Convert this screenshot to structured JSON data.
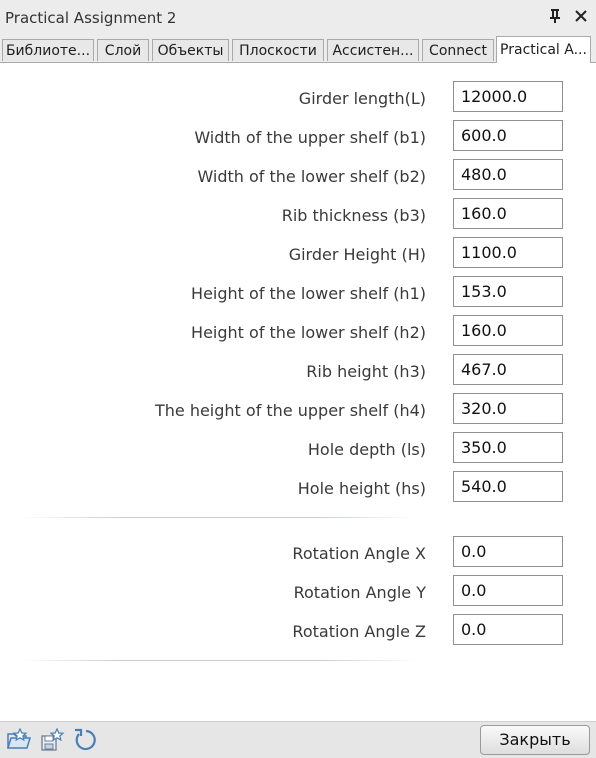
{
  "window": {
    "title": "Practical Assignment 2",
    "pin_icon": "pin-icon",
    "close_icon": "close-icon"
  },
  "tabs": [
    {
      "label": "Библиоте..."
    },
    {
      "label": "Слой"
    },
    {
      "label": "Объекты"
    },
    {
      "label": "Плоскости"
    },
    {
      "label": "Ассистен..."
    },
    {
      "label": "Connect"
    },
    {
      "label": "Practical A...",
      "active": true
    }
  ],
  "params": [
    {
      "label": "Girder length(L)",
      "value": "12000.0"
    },
    {
      "label": "Width of the upper shelf (b1)",
      "value": "600.0"
    },
    {
      "label": "Width of the lower shelf (b2)",
      "value": "480.0"
    },
    {
      "label": "Rib thickness (b3)",
      "value": "160.0"
    },
    {
      "label": "Girder Height (H)",
      "value": "1100.0"
    },
    {
      "label": "Height of the lower shelf (h1)",
      "value": "153.0"
    },
    {
      "label": "Height of the lower shelf (h2)",
      "value": "160.0"
    },
    {
      "label": "Rib height (h3)",
      "value": "467.0"
    },
    {
      "label": "The height of the upper shelf (h4)",
      "value": "320.0"
    },
    {
      "label": "Hole depth (ls)",
      "value": "350.0"
    },
    {
      "label": "Hole height (hs)",
      "value": "540.0"
    }
  ],
  "rotation": [
    {
      "label": "Rotation Angle X",
      "value": "0.0"
    },
    {
      "label": "Rotation Angle Y",
      "value": "0.0"
    },
    {
      "label": "Rotation Angle Z",
      "value": "0.0"
    }
  ],
  "footer": {
    "icons": [
      "open-favorite-icon",
      "save-favorite-icon",
      "reset-icon"
    ],
    "close_label": "Закрыть"
  },
  "colors": {
    "titlebar": "#ececec",
    "accent_icon": "#4a7fb5"
  }
}
